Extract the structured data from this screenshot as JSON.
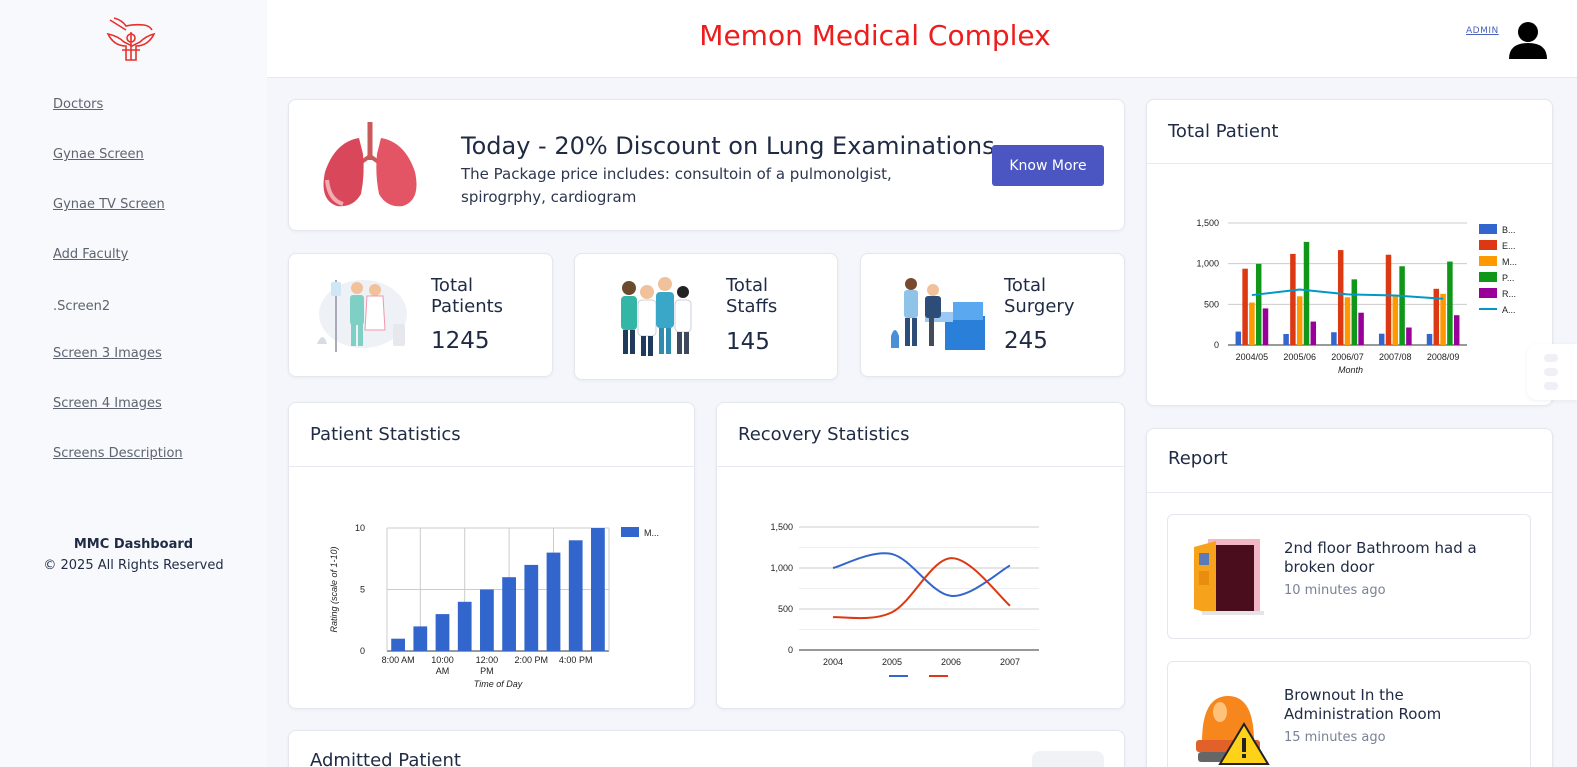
{
  "header": {
    "title": "Memon Medical Complex",
    "admin_label": "ADMIN"
  },
  "sidebar": {
    "items": [
      {
        "label": "Doctors"
      },
      {
        "label": "Gynae Screen"
      },
      {
        "label": "Gynae TV Screen"
      },
      {
        "label": "Add Faculty"
      },
      {
        "label": ".Screen2"
      },
      {
        "label": "Screen 3 Images"
      },
      {
        "label": "Screen 4 Images"
      },
      {
        "label": "Screens Description"
      }
    ],
    "footer_brand": "MMC Dashboard",
    "footer_copy": "© 2025 All Rights Reserved"
  },
  "promo": {
    "title": "Today - 20% Discount on Lung Examinations",
    "description": "The Package price includes: consultoin of a pulmonolgist, spirogrphy, cardiogram",
    "button": "Know More"
  },
  "stats": [
    {
      "label": "Total Patients",
      "value": "1245"
    },
    {
      "label": "Total Staffs",
      "value": "145"
    },
    {
      "label": "Total Surgery",
      "value": "245"
    }
  ],
  "cards": {
    "patient_statistics": "Patient Statistics",
    "recovery_statistics": "Recovery Statistics",
    "total_patient": "Total Patient",
    "report": "Report",
    "admitted_patient": "Admitted Patient"
  },
  "reports": [
    {
      "text": "2nd floor Bathroom had a broken door",
      "time": "10 minutes ago"
    },
    {
      "text": "Brownout In the Administration Room",
      "time": "15 minutes ago"
    }
  ],
  "chart_data": [
    {
      "id": "patient_statistics",
      "type": "bar",
      "x_tick_labels": [
        "8:00 AM",
        "10:00 AM",
        "12:00 PM",
        "2:00 PM",
        "4:00 PM"
      ],
      "values": [
        1,
        2,
        3,
        4,
        5,
        6,
        7,
        8,
        9,
        10
      ],
      "series": [
        {
          "name": "M...",
          "color": "#3366cc"
        }
      ],
      "xlabel": "Time of Day",
      "ylabel": "Rating (scale of 1-10)",
      "y_ticks": [
        "0",
        "5",
        "10"
      ],
      "ylim": [
        0,
        10
      ],
      "legend": "right"
    },
    {
      "id": "recovery_statistics",
      "type": "line",
      "x": [
        "2004",
        "2005",
        "2006",
        "2007"
      ],
      "series": [
        {
          "color": "#3366cc",
          "values": [
            1000,
            1170,
            660,
            1030
          ]
        },
        {
          "color": "#dc3912",
          "values": [
            400,
            460,
            1120,
            540
          ]
        }
      ],
      "y_ticks": [
        "0",
        "500",
        "1,000",
        "1,500"
      ],
      "ylim": [
        0,
        1500
      ],
      "legend": "bottom"
    },
    {
      "id": "total_patient",
      "type": "bar",
      "categories": [
        "2004/05",
        "2005/06",
        "2006/07",
        "2007/08",
        "2008/09"
      ],
      "xlabel": "Month",
      "y_ticks": [
        "0",
        "500",
        "1,000",
        "1,500"
      ],
      "ylim": [
        0,
        1500
      ],
      "legend": "right",
      "series": [
        {
          "name": "B...",
          "color": "#3366cc",
          "values": [
            165,
            135,
            157,
            139,
            136
          ]
        },
        {
          "name": "E...",
          "color": "#dc3912",
          "values": [
            938,
            1120,
            1167,
            1110,
            691
          ]
        },
        {
          "name": "M...",
          "color": "#ff9900",
          "values": [
            522,
            599,
            587,
            615,
            629
          ]
        },
        {
          "name": "P...",
          "color": "#109618",
          "values": [
            998,
            1268,
            807,
            968,
            1026
          ]
        },
        {
          "name": "R...",
          "color": "#990099",
          "values": [
            450,
            288,
            397,
            215,
            366
          ]
        },
        {
          "name": "A...",
          "color": "#0099c6",
          "type": "line",
          "values": [
            614,
            682,
            623,
            609,
            569
          ]
        }
      ]
    }
  ]
}
